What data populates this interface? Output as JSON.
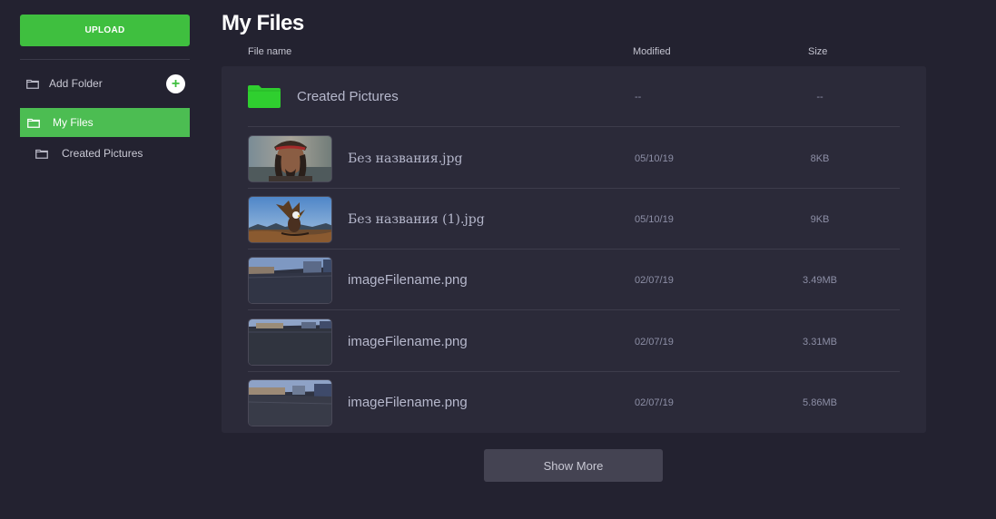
{
  "sidebar": {
    "upload_label": "UPLOAD",
    "add_folder_label": "Add Folder",
    "add_icon": "plus-icon",
    "items": [
      {
        "label": "My Files",
        "icon": "folder-icon",
        "active": true
      },
      {
        "label": "Created Pictures",
        "icon": "folder-icon",
        "active": false
      }
    ]
  },
  "main": {
    "title": "My Files",
    "columns": {
      "name": "File name",
      "modified": "Modified",
      "size": "Size"
    },
    "rows": [
      {
        "type": "folder",
        "name": "Created Pictures",
        "modified": "--",
        "size": "--",
        "icon": "folder-icon"
      },
      {
        "type": "image",
        "name": "Без названия.jpg",
        "modified": "05/10/19",
        "size": "8KB",
        "thumb": "portrait-photo"
      },
      {
        "type": "image",
        "name": "Без названия (1).jpg",
        "modified": "05/10/19",
        "size": "9KB",
        "thumb": "eagle-photo"
      },
      {
        "type": "image",
        "name": "imageFilename.png",
        "modified": "02/07/19",
        "size": "3.49MB",
        "thumb": "parking-lot-photo"
      },
      {
        "type": "image",
        "name": "imageFilename.png",
        "modified": "02/07/19",
        "size": "3.31MB",
        "thumb": "parking-lot-photo"
      },
      {
        "type": "image",
        "name": "imageFilename.png",
        "modified": "02/07/19",
        "size": "5.86MB",
        "thumb": "parking-lot-photo"
      }
    ],
    "show_more_label": "Show More"
  },
  "colors": {
    "background": "#232230",
    "panel": "#2b2a39",
    "accent_green": "#3fbf3f",
    "active_item": "#4cbd52",
    "button_gray": "#444352"
  }
}
